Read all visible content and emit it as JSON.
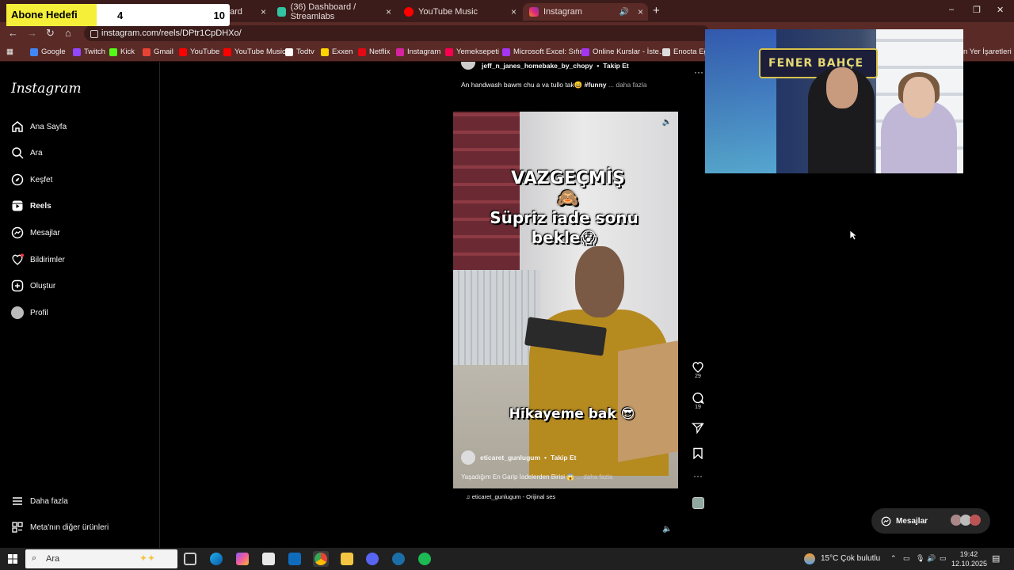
{
  "overlay": {
    "label": "Abone Hedefi",
    "current": "4",
    "goal": "10"
  },
  "tabs": [
    {
      "title": "ard",
      "close": "×"
    },
    {
      "title": "(36) Dashboard / Streamlabs",
      "close": "×"
    },
    {
      "title": "YouTube Music",
      "close": "×"
    },
    {
      "title": "Instagram",
      "close": "×"
    }
  ],
  "new_tab": "+",
  "window_controls": [
    "–",
    "❐",
    "✕"
  ],
  "address": {
    "url": "instagram.com/reels/DPtr1CpDHXo/"
  },
  "bookmarks": [
    {
      "label": "Google",
      "color": "#4285f4"
    },
    {
      "label": "Twitch",
      "color": "#9146ff"
    },
    {
      "label": "Kick",
      "color": "#53fc18"
    },
    {
      "label": "Gmail",
      "color": "#ea4335"
    },
    {
      "label": "YouTube",
      "color": "#ff0000"
    },
    {
      "label": "YouTube Music",
      "color": "#ff0000"
    },
    {
      "label": "Todtv",
      "color": "#ffffff"
    },
    {
      "label": "Exxen",
      "color": "#ffd400"
    },
    {
      "label": "Netflix",
      "color": "#e50914"
    },
    {
      "label": "Instagram",
      "color": "#d6249f"
    },
    {
      "label": "Yemeksepeti",
      "color": "#fa0050"
    },
    {
      "label": "Microsoft Excel: Sıfır...",
      "color": "#a435f0"
    },
    {
      "label": "Online Kurslar - İste...",
      "color": "#a435f0"
    },
    {
      "label": "Enocta Eği",
      "color": "#dddddd"
    }
  ],
  "bookmarks_right": "n Yer İşaretleri",
  "sidebar": {
    "logo": "Instagram",
    "items": [
      {
        "label": "Ana Sayfa",
        "icon": "home-icon"
      },
      {
        "label": "Ara",
        "icon": "search-icon"
      },
      {
        "label": "Keşfet",
        "icon": "compass-icon"
      },
      {
        "label": "Reels",
        "icon": "reels-icon"
      },
      {
        "label": "Mesajlar",
        "icon": "messenger-icon"
      },
      {
        "label": "Bildirimler",
        "icon": "heart-icon"
      },
      {
        "label": "Oluştur",
        "icon": "plus-square-icon"
      },
      {
        "label": "Profil",
        "icon": "profile-avatar"
      }
    ],
    "more": "Daha fazla",
    "meta": "Meta'nın diğer ürünleri"
  },
  "prev_reel": {
    "username": "jeff_n_janes_homebake_by_chopy",
    "sep": "•",
    "follow": "Takip Et",
    "caption": "An handwash bawm chu a va tullo tak😄",
    "hashtag": "#funny",
    "more": "... daha fazla"
  },
  "reel": {
    "overlay_1": "VAZGEÇMİŞ 🙈",
    "overlay_2": "Süpriz iade sonu bekle😱",
    "overlay_3": "Hikayeme bak 😎",
    "username": "eticaret_gunlugum",
    "sep": "•",
    "follow": "Takip Et",
    "caption": "Yaşadığım En Garip İadelerden Birisi 😱",
    "more": "... daha fazla",
    "audio": "eticaret_gunlugum - Orijinal ses",
    "likes": "29",
    "comments": "19"
  },
  "webcam": {
    "scarf_text": "FENER BAHÇE"
  },
  "messages_pill": {
    "label": "Mesajlar"
  },
  "taskbar": {
    "search": "Ara",
    "weather": "15°C  Çok bulutlu",
    "time": "19:42",
    "date": "12.10.2025"
  }
}
